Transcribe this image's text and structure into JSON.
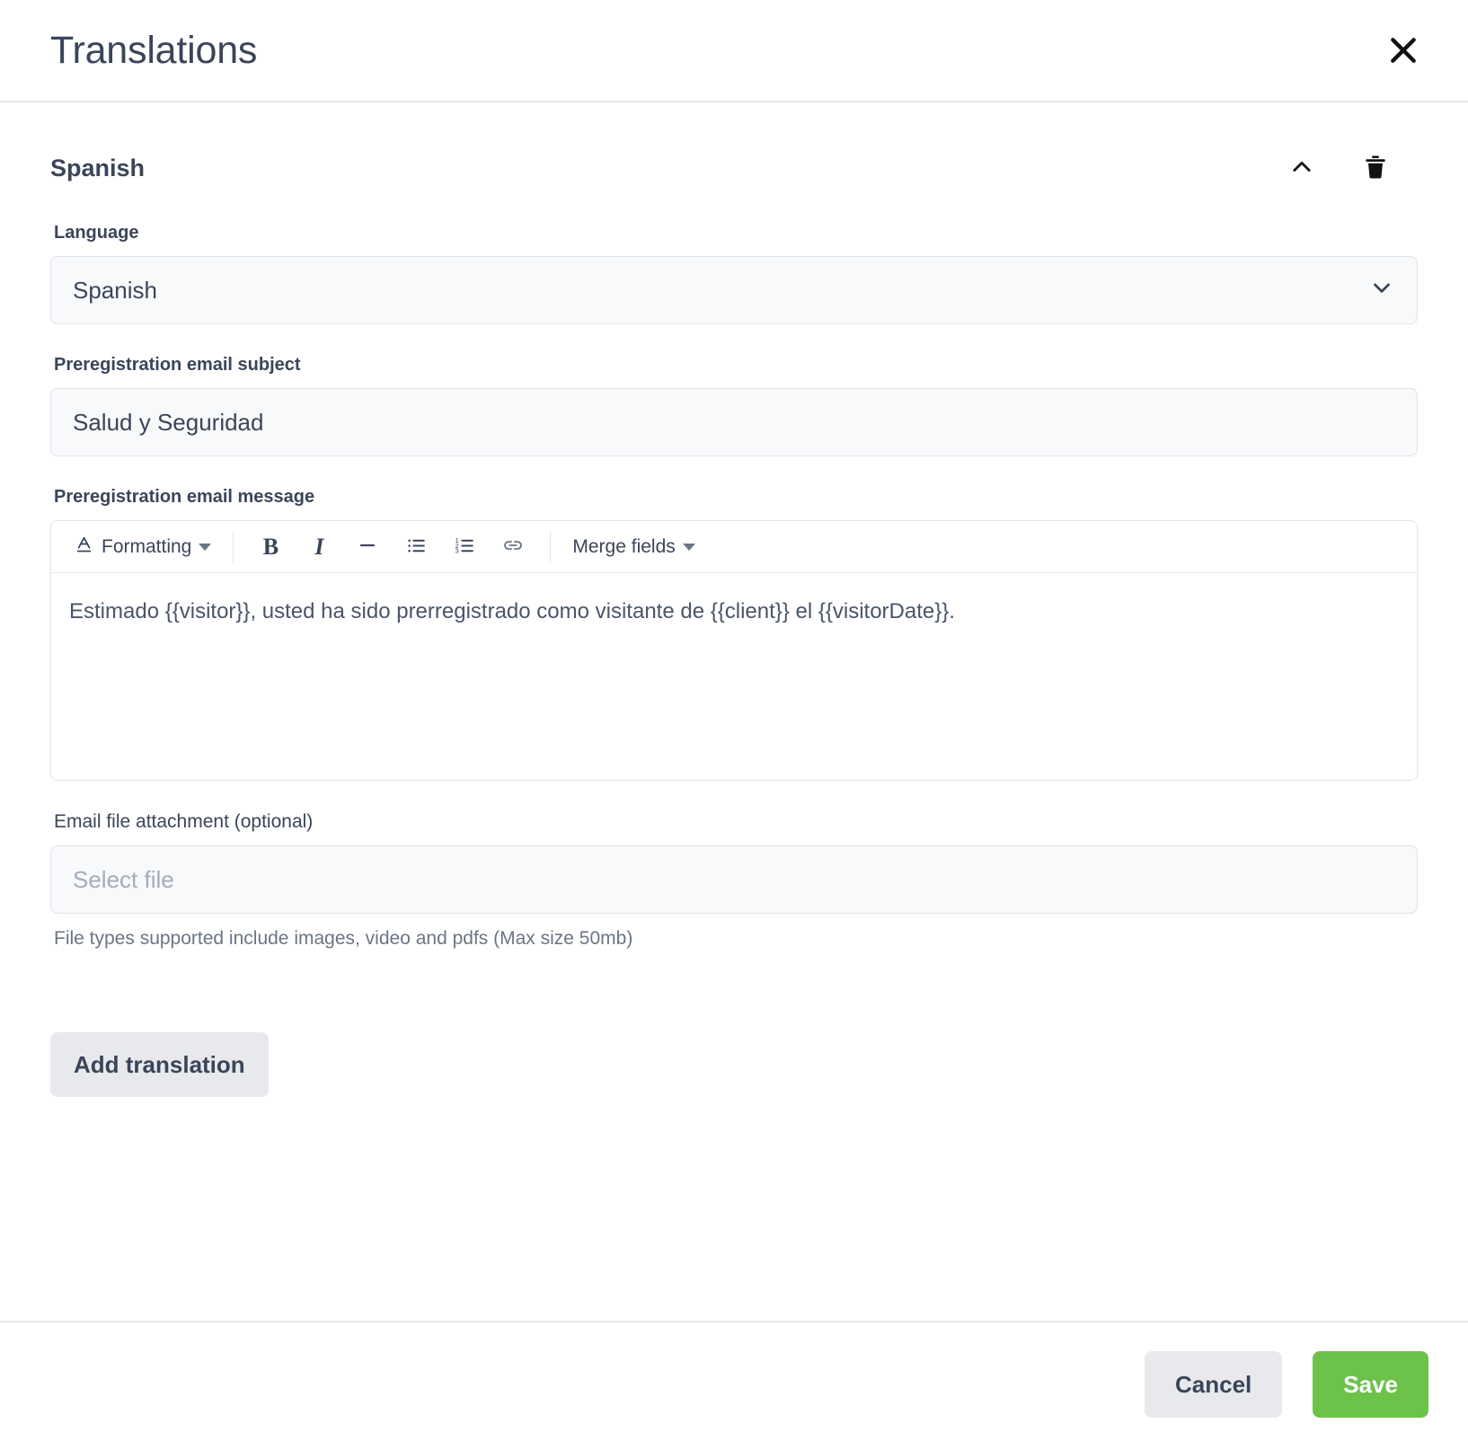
{
  "dialog": {
    "title": "Translations",
    "close_icon": "close-icon"
  },
  "translation": {
    "section_title": "Spanish",
    "collapse_icon": "chevron-up-icon",
    "delete_icon": "trash-icon",
    "fields": {
      "language": {
        "label": "Language",
        "value": "Spanish",
        "chevron_icon": "chevron-down-icon"
      },
      "subject": {
        "label": "Preregistration email subject",
        "value": "Salud y Seguridad"
      },
      "message": {
        "label": "Preregistration email message",
        "value": "Estimado {{visitor}}, usted ha sido prerregistrado como visitante de {{client}} el {{visitorDate}}."
      },
      "attachment": {
        "label": "Email file attachment (optional)",
        "placeholder": "Select file",
        "help": "File types supported include images, video and pdfs (Max size 50mb)"
      }
    },
    "toolbar": {
      "formatting_label": "Formatting",
      "formatting_icon": "text-format-icon",
      "bold_icon": "bold-icon",
      "bold_label": "B",
      "italic_icon": "italic-icon",
      "italic_label": "I",
      "hr_icon": "horizontal-rule-icon",
      "bullet_list_icon": "bullet-list-icon",
      "numbered_list_icon": "numbered-list-icon",
      "link_icon": "link-icon",
      "merge_fields_label": "Merge fields",
      "caret_icon": "caret-down-icon"
    },
    "add_translation_label": "Add translation"
  },
  "footer": {
    "cancel_label": "Cancel",
    "save_label": "Save"
  },
  "colors": {
    "accent_green": "#6cc24a",
    "text_dark": "#3b4559",
    "muted": "#6b7583",
    "field_bg": "#f8f9fb",
    "border": "#dfe3e8"
  }
}
